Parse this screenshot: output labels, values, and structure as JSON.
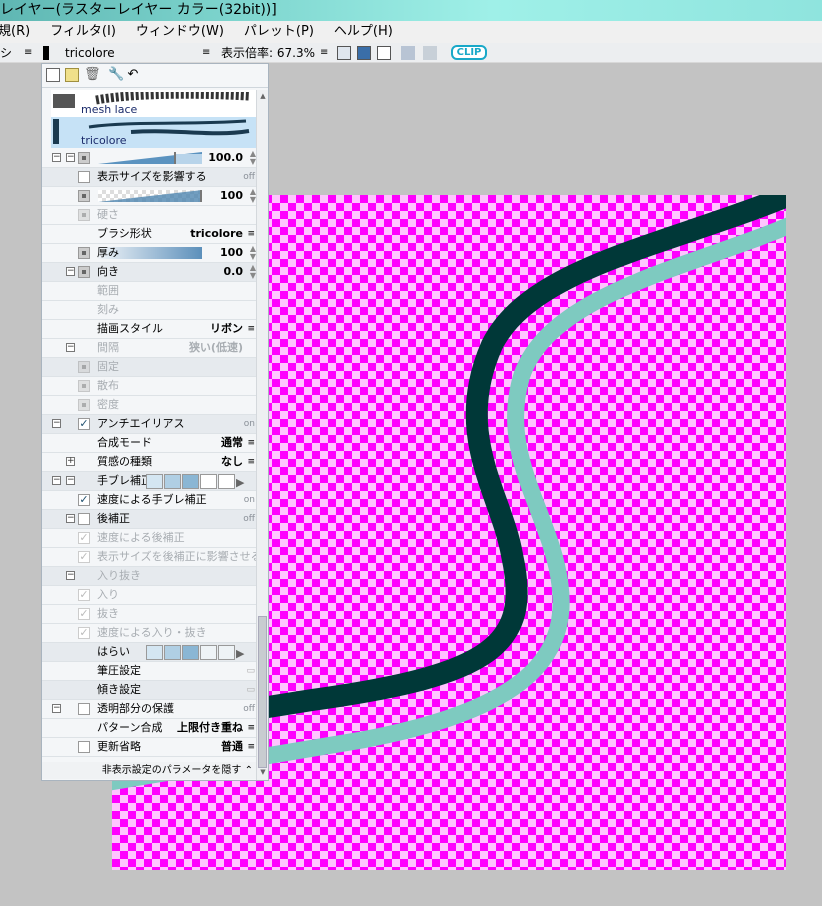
{
  "title": "レイヤー(ラスターレイヤー カラー(32bit))]",
  "menu": [
    "規(R)",
    "フィルタ(I)",
    "ウィンドウ(W)",
    "パレット(P)",
    "ヘルプ(H)"
  ],
  "toolbar": {
    "left_label": "シ",
    "brush_name": "tricolore",
    "zoom_label": "表示倍率: 67.3%",
    "logo": "CLIP"
  },
  "brushes": [
    {
      "name": "mesh lace"
    },
    {
      "name": "tricolore",
      "selected": true
    }
  ],
  "rows": [
    {
      "kind": "slider",
      "val": "100.0",
      "stp": true,
      "tree": [
        1,
        2
      ]
    },
    {
      "kind": "check",
      "name": "表示サイズを影響する",
      "val": "off",
      "small": true,
      "shade": true,
      "checked": false
    },
    {
      "kind": "slider",
      "val": "100",
      "stp": true,
      "checker": true
    },
    {
      "kind": "sq",
      "name": "硬さ",
      "dis": true
    },
    {
      "kind": "plain",
      "name": "ブラシ形状",
      "val": "tricolore",
      "dd": true
    },
    {
      "kind": "sq",
      "name": "厚み",
      "val": "100",
      "stp": true,
      "slider": true
    },
    {
      "kind": "sq",
      "name": "向き",
      "val": "0.0",
      "stp": true,
      "shade": true,
      "tree": [
        2
      ]
    },
    {
      "kind": "plain",
      "name": "範囲",
      "dis": true
    },
    {
      "kind": "plain",
      "name": "刻み",
      "dis": true
    },
    {
      "kind": "plain",
      "name": "描画スタイル",
      "val": "リボン",
      "dd": true
    },
    {
      "kind": "plain",
      "name": "間隔",
      "val": "狭い(低速)",
      "dis": true,
      "tree": [
        2
      ]
    },
    {
      "kind": "sq",
      "name": "固定",
      "dis": true,
      "shade": true
    },
    {
      "kind": "sq",
      "name": "散布",
      "dis": true
    },
    {
      "kind": "sq",
      "name": "密度",
      "dis": true
    },
    {
      "kind": "check",
      "name": "アンチエイリアス",
      "val": "on",
      "small": true,
      "checked": true,
      "shade": true,
      "tree": [
        1
      ]
    },
    {
      "kind": "plain",
      "name": "合成モード",
      "val": "通常",
      "dd": true
    },
    {
      "kind": "plain",
      "name": "質感の種類",
      "val": "なし",
      "dd": true,
      "plus": true
    },
    {
      "kind": "boxes",
      "name": "手ブレ補正",
      "boxes": 3,
      "shade": true,
      "tree": [
        1,
        2
      ]
    },
    {
      "kind": "check",
      "name": "速度による手ブレ補正",
      "val": "on",
      "small": true,
      "checked": true
    },
    {
      "kind": "check",
      "name": "後補正",
      "val": "off",
      "small": true,
      "checked": false,
      "shade": true,
      "tree": [
        2
      ]
    },
    {
      "kind": "check",
      "name": "速度による後補正",
      "checked": true,
      "dis": true
    },
    {
      "kind": "check",
      "name": "表示サイズを後補正に影響させる",
      "checked": true,
      "dis": true
    },
    {
      "kind": "plain",
      "name": "入り抜き",
      "dis": true,
      "shade": true,
      "tree": [
        2
      ]
    },
    {
      "kind": "check",
      "name": "入り",
      "checked": true,
      "dis": true
    },
    {
      "kind": "check",
      "name": "抜き",
      "checked": true,
      "dis": true
    },
    {
      "kind": "check",
      "name": "速度による入り・抜き",
      "checked": true,
      "dis": true
    },
    {
      "kind": "boxes",
      "name": "はらい",
      "boxes": 3,
      "shade": true
    },
    {
      "kind": "plain",
      "name": "筆圧設定",
      "icon": true
    },
    {
      "kind": "plain",
      "name": "傾き設定",
      "icon": true,
      "shade": true
    },
    {
      "kind": "check",
      "name": "透明部分の保護",
      "val": "off",
      "small": true,
      "checked": false,
      "tree": [
        1
      ]
    },
    {
      "kind": "plain",
      "name": "パターン合成",
      "val": "上限付き重ね",
      "dd": true
    },
    {
      "kind": "check",
      "name": "更新省略",
      "val": "普通",
      "dd": true,
      "checked": false
    }
  ],
  "footer": "非表示設定のパラメータを隠す",
  "colors": {
    "stroke_dark": "#003838",
    "stroke_light": "#7ecac0",
    "checker_a": "#ff00ff",
    "checker_b": "#ffc4ff"
  }
}
